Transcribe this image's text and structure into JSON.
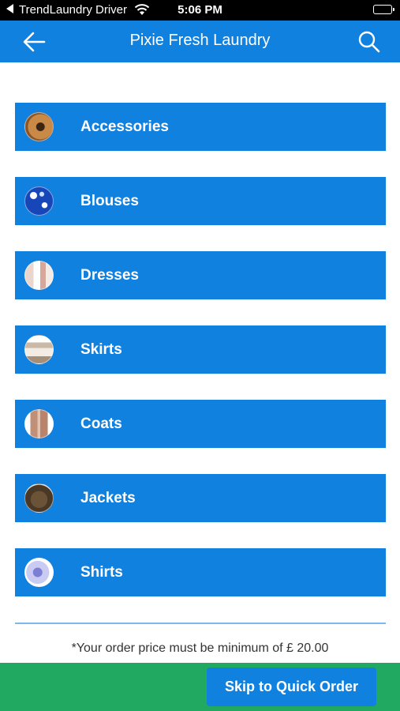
{
  "status_bar": {
    "carrier": "TrendLaundry Driver",
    "time": "5:06 PM"
  },
  "header": {
    "title": "Pixie Fresh Laundry",
    "back_icon": "arrow-left-icon",
    "search_icon": "search-icon"
  },
  "categories": [
    {
      "label": "Accessories"
    },
    {
      "label": "Blouses"
    },
    {
      "label": "Dresses"
    },
    {
      "label": "Skirts"
    },
    {
      "label": "Coats"
    },
    {
      "label": "Jackets"
    },
    {
      "label": "Shirts"
    }
  ],
  "footer": {
    "min_order_note": "*Your order price must be minimum of £  20.00",
    "skip_label": "Skip to Quick Order"
  },
  "colors": {
    "primary": "#1181e0",
    "bottom_bar": "#22a961",
    "status_bar": "#000000"
  }
}
